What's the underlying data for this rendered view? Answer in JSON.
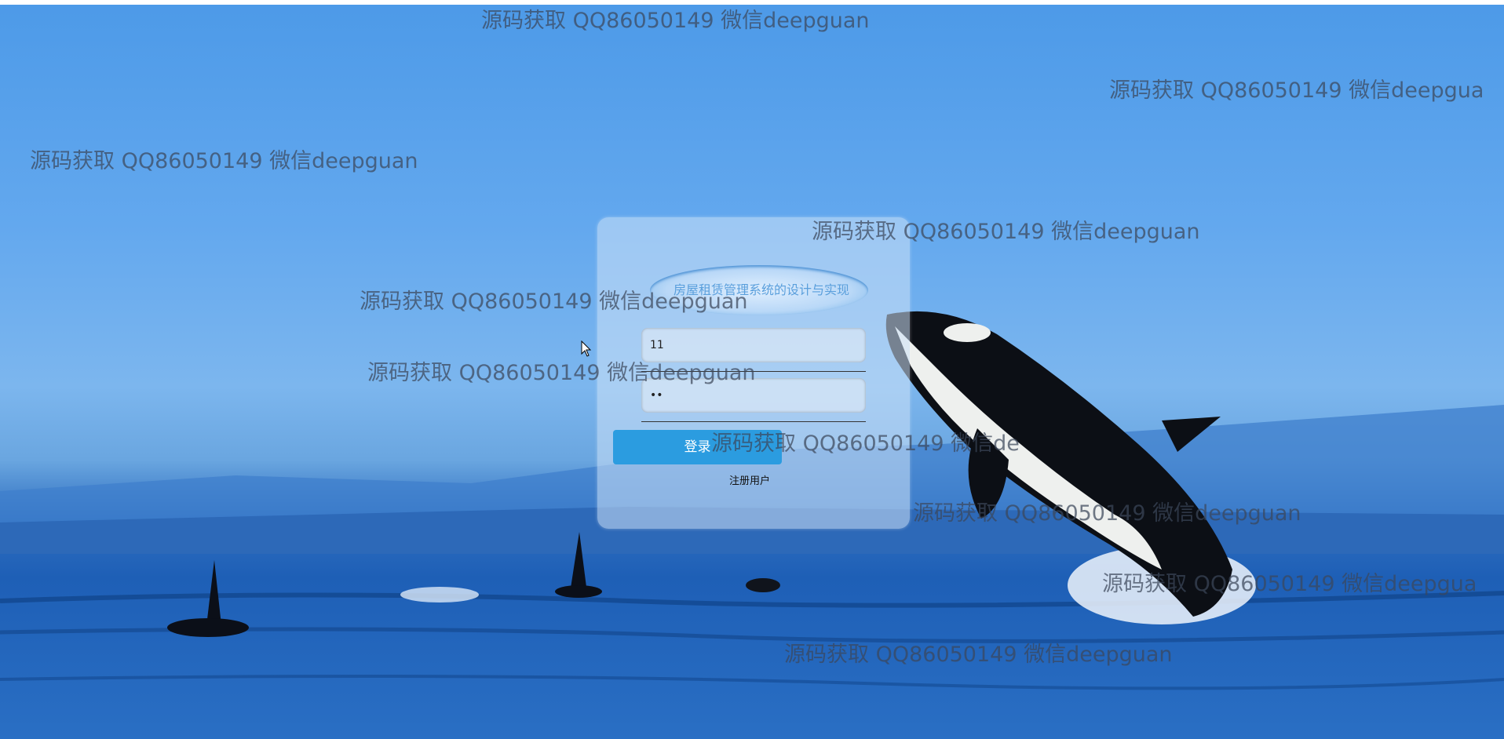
{
  "login": {
    "title": "房屋租赁管理系统的设计与实现",
    "username_value": "11",
    "password_value": "••",
    "login_button_label": "登录",
    "register_link_label": "注册用户"
  },
  "watermarks": [
    "源码获取 QQ86050149 微信deepguan",
    "源码获取 QQ86050149 微信deepgua",
    "源码获取 QQ86050149 微信deepguan",
    "源码获取 QQ86050149 微信deepguan",
    "源码获取 QQ86050149 微信deepguan",
    "源码获取 QQ86050149 微信deepguan",
    "源码获取 QQ86050149 微信de",
    "源码获取 QQ86050149 微信deepguan",
    "源码获取 QQ86050149 微信deepgua",
    "源码获取 QQ86050149 微信deepguan"
  ],
  "colors": {
    "button": "#2b9ce0",
    "title": "#5a9fdc",
    "sky": "#4d9ae8",
    "sea": "#1e5fb6"
  },
  "icons": {
    "cursor": "mouse-pointer-icon"
  }
}
